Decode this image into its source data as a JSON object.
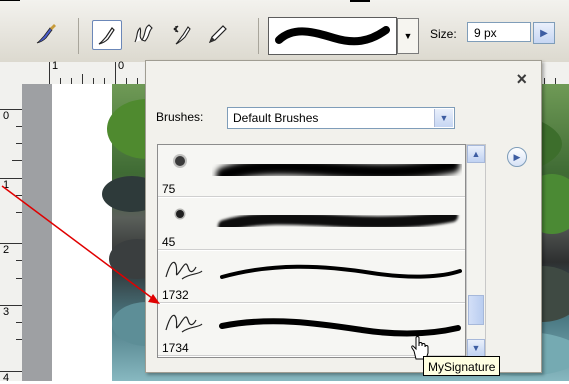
{
  "options_bar": {
    "tools": [
      "brush-tool",
      "impressionist-brush",
      "color-replacement",
      "pencil"
    ],
    "size_label": "Size:",
    "size_value": "9 px"
  },
  "rulers": {
    "top_numbers": [
      "1",
      "0"
    ],
    "left_numbers": [
      "0",
      "1",
      "2",
      "3",
      "4"
    ]
  },
  "brush_panel": {
    "brushes_label": "Brushes:",
    "brushes_selected": "Default Brushes",
    "close_glyph": "×",
    "items": [
      {
        "size": "75",
        "kind": "soft-round"
      },
      {
        "size": "45",
        "kind": "hard-round"
      },
      {
        "size": "1732",
        "kind": "signature"
      },
      {
        "size": "1734",
        "kind": "signature"
      }
    ]
  },
  "tooltip": "MySignature",
  "colors": {
    "accent": "#3d5da2",
    "annotation": "#e00000"
  }
}
